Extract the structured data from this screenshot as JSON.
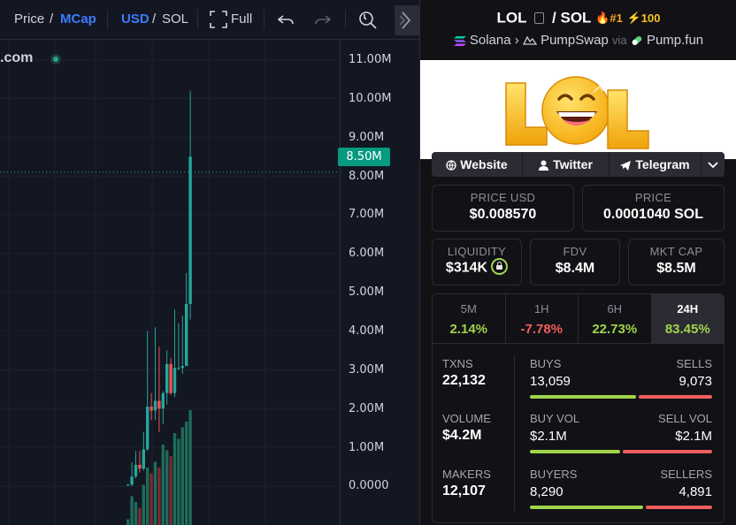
{
  "toolbar": {
    "price_label": "Price",
    "slash1": "/",
    "mcap_label": "MCap",
    "usd_label": "USD",
    "slash2": "/",
    "sol_label": "SOL",
    "full_label": "Full"
  },
  "chart": {
    "site_fragment": ".com",
    "current_tag": "8.50M",
    "axis_labels": [
      "11.00M",
      "10.00M",
      "9.00M",
      "8.00M",
      "7.00M",
      "6.00M",
      "5.00M",
      "4.00M",
      "3.00M",
      "2.00M",
      "1.00M",
      "0.0000"
    ],
    "colors": {
      "up": "#26a69a",
      "down": "#ef5350",
      "vol_up": "#1e6b5a",
      "vol_down": "#7a2a33"
    }
  },
  "chart_data": {
    "type": "candlestick",
    "y_unit": "market cap (USD)",
    "ylim": [
      0,
      11000000
    ],
    "last_value": "8.50M",
    "candles": [
      {
        "o": 0.02,
        "h": 0.05,
        "l": 0.0,
        "c": 0.04
      },
      {
        "o": 0.04,
        "h": 0.62,
        "l": 0.0,
        "c": 0.25
      },
      {
        "o": 0.25,
        "h": 0.9,
        "l": 0.2,
        "c": 0.55
      },
      {
        "o": 0.55,
        "h": 0.9,
        "l": 0.35,
        "c": 0.45
      },
      {
        "o": 0.45,
        "h": 1.4,
        "l": 0.4,
        "c": 0.95
      },
      {
        "o": 0.95,
        "h": 4.0,
        "l": 0.9,
        "c": 2.05
      },
      {
        "o": 2.05,
        "h": 2.4,
        "l": 1.7,
        "c": 1.95
      },
      {
        "o": 1.95,
        "h": 4.1,
        "l": 1.7,
        "c": 2.2
      },
      {
        "o": 2.2,
        "h": 3.6,
        "l": 1.4,
        "c": 2.0
      },
      {
        "o": 2.0,
        "h": 2.45,
        "l": 1.6,
        "c": 2.4
      },
      {
        "o": 2.4,
        "h": 3.5,
        "l": 2.1,
        "c": 3.15
      },
      {
        "o": 3.15,
        "h": 3.3,
        "l": 2.35,
        "c": 2.4
      },
      {
        "o": 2.4,
        "h": 4.55,
        "l": 2.3,
        "c": 3.05
      },
      {
        "o": 3.05,
        "h": 4.2,
        "l": 3.0,
        "c": 3.05
      },
      {
        "o": 3.05,
        "h": 4.4,
        "l": 2.9,
        "c": 3.1
      },
      {
        "o": 3.1,
        "h": 5.5,
        "l": 3.1,
        "c": 4.7
      },
      {
        "o": 4.7,
        "h": 10.2,
        "l": 4.3,
        "c": 8.5
      }
    ],
    "volumes": [
      0.05,
      0.25,
      0.2,
      0.15,
      0.35,
      0.5,
      0.45,
      0.55,
      0.5,
      0.7,
      0.65,
      0.6,
      0.8,
      0.75,
      0.85,
      0.9,
      1.0
    ]
  },
  "token": {
    "symbol": "LOL",
    "slash": "/",
    "quote": "SOL",
    "rank": "#1",
    "boosts": "100",
    "chain": "Solana",
    "dex": "PumpSwap",
    "via": "via",
    "launchpad": "Pump.fun",
    "banner_text": "LOL"
  },
  "links": {
    "website": "Website",
    "twitter": "Twitter",
    "telegram": "Telegram"
  },
  "price": {
    "usd_label": "PRICE USD",
    "usd_value": "$0.008570",
    "native_label": "PRICE",
    "native_value": "0.0001040 SOL"
  },
  "metrics": {
    "liquidity_label": "LIQUIDITY",
    "liquidity_value": "$314K",
    "fdv_label": "FDV",
    "fdv_value": "$8.4M",
    "mcap_label": "MKT CAP",
    "mcap_value": "$8.5M"
  },
  "timeframes": [
    {
      "name": "5M",
      "value": "2.14%"
    },
    {
      "name": "1H",
      "value": "-7.78%"
    },
    {
      "name": "6H",
      "value": "22.73%"
    },
    {
      "name": "24H",
      "value": "83.45%"
    }
  ],
  "stats": {
    "txns_label": "TXNS",
    "txns_value": "22,132",
    "buys_label": "BUYS",
    "buys_value": "13,059",
    "sells_label": "SELLS",
    "sells_value": "9,073",
    "volume_label": "VOLUME",
    "volume_value": "$4.2M",
    "buy_vol_label": "BUY VOL",
    "buy_vol_value": "$2.1M",
    "sell_vol_label": "SELL VOL",
    "sell_vol_value": "$2.1M",
    "makers_label": "MAKERS",
    "makers_value": "12,107",
    "buyers_label": "BUYERS",
    "buyers_value": "8,290",
    "sellers_label": "SELLERS",
    "sellers_value": "4,891",
    "buy_share": 0.59,
    "buy_vol_share": 0.5,
    "buyer_share": 0.63
  }
}
